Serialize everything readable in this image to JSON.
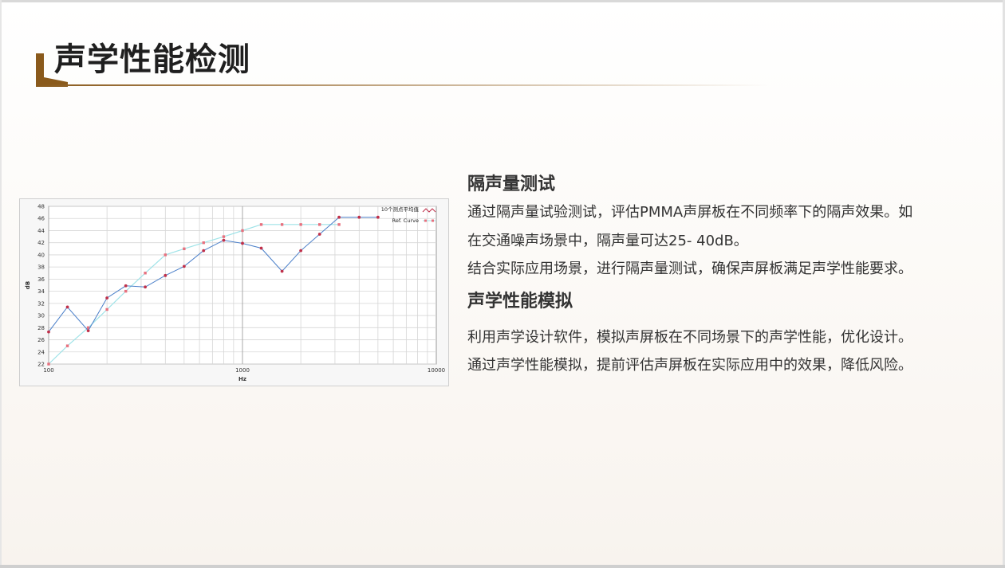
{
  "page": {
    "title": "声学性能检测"
  },
  "sections": [
    {
      "heading": "隔声量测试",
      "paragraphs": [
        "通过隔声量试验测试，评估PMMA声屏板在不同频率下的隔声效果。如在交通噪声场景中，隔声量可达25- 40dB。",
        "结合实际应用场景，进行隔声量测试，确保声屏板满足声学性能要求。"
      ]
    },
    {
      "heading": "声学性能模拟",
      "paragraphs": [
        "利用声学设计软件，模拟声屏板在不同场景下的声学性能，优化设计。",
        "通过声学性能模拟，提前评估声屏板在实际应用中的效果，降低风险。"
      ]
    }
  ],
  "colors": {
    "accent": "#8a5a1c",
    "measured_line": "#4a7fc9",
    "measured_point": "#c0304a",
    "ref_line": "#9fe3e8",
    "ref_point": "#e8707e"
  },
  "chart_data": {
    "type": "line",
    "xscale": "log",
    "xlim": [
      100,
      10000
    ],
    "ylim": [
      22,
      48
    ],
    "xlabel": "Hz",
    "ylabel": "dB",
    "xticks": [
      "100",
      "1000",
      "10000"
    ],
    "yticks": [
      "22",
      "24",
      "26",
      "28",
      "30",
      "32",
      "34",
      "36",
      "38",
      "40",
      "42",
      "44",
      "46",
      "48"
    ],
    "legend_position": "top-right",
    "series": [
      {
        "name": "10个测点平均值",
        "x": [
          100,
          125,
          160,
          200,
          250,
          315,
          400,
          500,
          630,
          800,
          1000,
          1250,
          1600,
          2000,
          2500,
          3150,
          4000,
          5000
        ],
        "y": [
          27.3,
          31.4,
          27.5,
          32.9,
          34.9,
          34.7,
          36.6,
          38.1,
          40.7,
          42.4,
          41.9,
          41.1,
          37.3,
          40.7,
          43.4,
          46.2,
          46.2,
          46.2
        ]
      },
      {
        "name": "Ref. Curve",
        "x": [
          100,
          125,
          160,
          200,
          250,
          315,
          400,
          500,
          630,
          800,
          1000,
          1250,
          1600,
          2000,
          2500,
          3150
        ],
        "y": [
          22,
          25,
          28,
          31,
          34,
          37,
          40,
          41,
          42,
          43,
          44,
          45,
          45,
          45,
          45,
          45
        ]
      }
    ]
  }
}
